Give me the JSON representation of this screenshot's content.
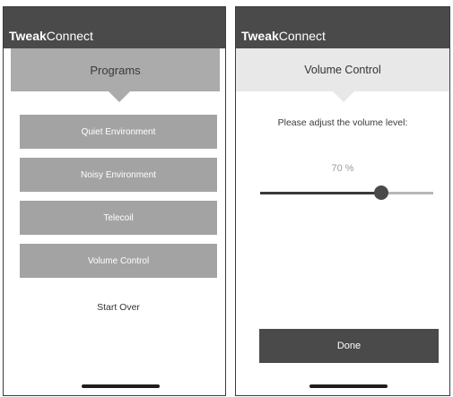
{
  "left": {
    "brand": {
      "bold": "Tweak",
      "regular": "Connect"
    },
    "header": "Programs",
    "programs": [
      "Quiet Environment",
      "Noisy Environment",
      "Telecoil",
      "Volume Control"
    ],
    "start_over": "Start Over"
  },
  "right": {
    "brand": {
      "bold": "Tweak",
      "regular": "Connect"
    },
    "header": "Volume Control",
    "prompt": "Please adjust the volume level:",
    "volume_text": "70 %",
    "volume_fraction": 0.7,
    "done": "Done"
  },
  "colors": {
    "appbar": "#4a4a4a",
    "left_header": "#ababab",
    "program_button": "#a3a3a3",
    "right_header": "#e8e8e8",
    "done_button": "#4a4a4a"
  }
}
